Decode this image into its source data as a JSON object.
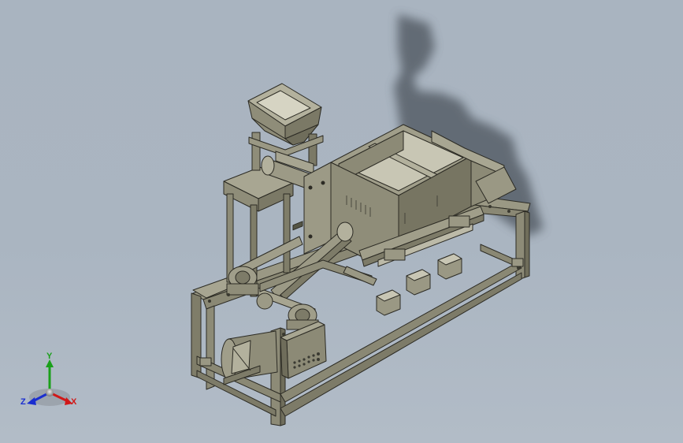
{
  "viewport": {
    "background_top": "#a9b4c0",
    "background_bottom": "#b2bcc7",
    "model_color": "#8c8a76",
    "shadow_color": "#4d545c"
  },
  "triad": {
    "x_label": "X",
    "y_label": "Y",
    "z_label": "Z",
    "x_color": "#d01818",
    "y_color": "#1aa01a",
    "z_color": "#1a2ed0"
  }
}
